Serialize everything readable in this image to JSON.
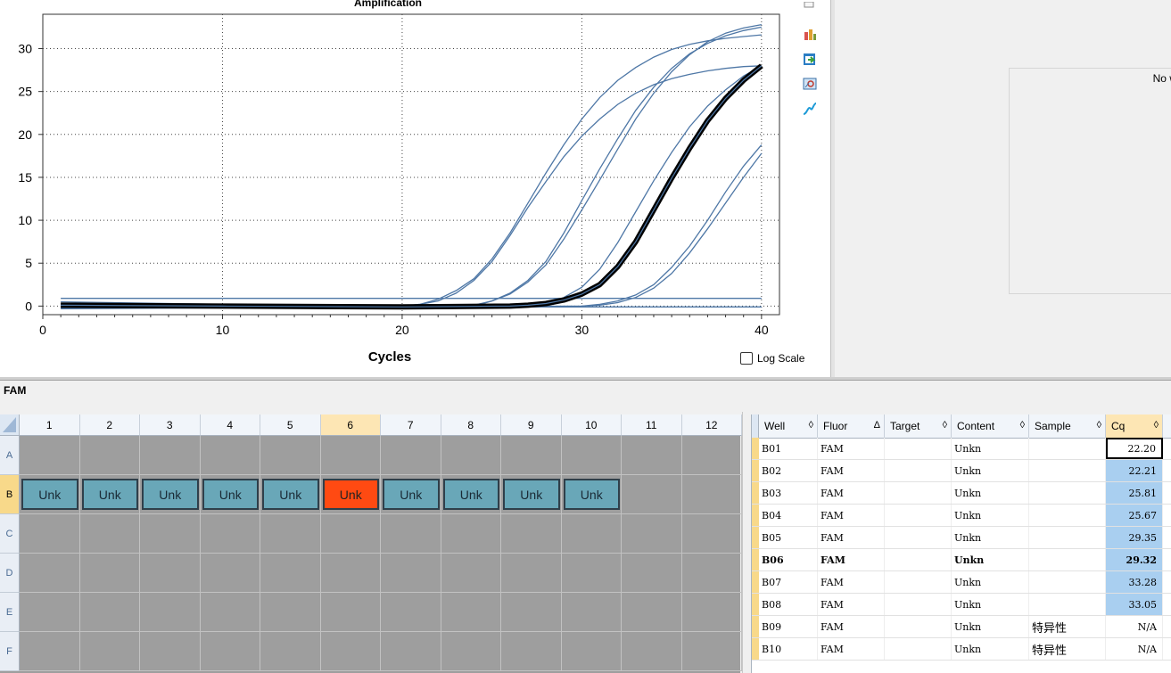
{
  "chart": {
    "title": "Amplification",
    "xlabel": "Cycles",
    "log_scale_label": "Log Scale",
    "log_scale_checked": false
  },
  "chart_data": {
    "type": "line",
    "title": "Amplification",
    "xlabel": "Cycles",
    "ylabel": "",
    "xlim": [
      0,
      41
    ],
    "ylim": [
      -1,
      34
    ],
    "xticks": [
      0,
      10,
      20,
      30,
      40
    ],
    "yticks": [
      0,
      5,
      10,
      15,
      20,
      25,
      30
    ],
    "grid": true,
    "highlight_color": "#000000",
    "series_color": "#4e77a6",
    "series": [
      {
        "name": "B01",
        "highlight": false,
        "points": [
          [
            1,
            -0.1
          ],
          [
            10,
            -0.1
          ],
          [
            20,
            0
          ],
          [
            21,
            0.2
          ],
          [
            22,
            0.8
          ],
          [
            23,
            1.8
          ],
          [
            24,
            3.2
          ],
          [
            25,
            5.5
          ],
          [
            26,
            8.5
          ],
          [
            27,
            12
          ],
          [
            28,
            15.5
          ],
          [
            29,
            18.8
          ],
          [
            30,
            21.8
          ],
          [
            31,
            24.3
          ],
          [
            32,
            26.3
          ],
          [
            33,
            27.8
          ],
          [
            34,
            29
          ],
          [
            35,
            29.9
          ],
          [
            36,
            30.5
          ],
          [
            37,
            30.9
          ],
          [
            38,
            31.2
          ],
          [
            39,
            31.4
          ],
          [
            40,
            31.6
          ]
        ]
      },
      {
        "name": "B02",
        "highlight": false,
        "points": [
          [
            1,
            0.2
          ],
          [
            10,
            0.1
          ],
          [
            20,
            0
          ],
          [
            21,
            0.2
          ],
          [
            22,
            0.6
          ],
          [
            23,
            1.5
          ],
          [
            24,
            3
          ],
          [
            25,
            5.2
          ],
          [
            26,
            8.2
          ],
          [
            27,
            11.5
          ],
          [
            28,
            14.5
          ],
          [
            29,
            17.4
          ],
          [
            30,
            19.8
          ],
          [
            31,
            21.8
          ],
          [
            32,
            23.5
          ],
          [
            33,
            24.8
          ],
          [
            34,
            25.8
          ],
          [
            35,
            26.5
          ],
          [
            36,
            27
          ],
          [
            37,
            27.4
          ],
          [
            38,
            27.7
          ],
          [
            39,
            27.9
          ],
          [
            40,
            28
          ]
        ]
      },
      {
        "name": "B03",
        "highlight": false,
        "points": [
          [
            1,
            -0.3
          ],
          [
            10,
            -0.2
          ],
          [
            20,
            -0.1
          ],
          [
            24,
            0
          ],
          [
            25,
            0.6
          ],
          [
            26,
            1.5
          ],
          [
            27,
            3
          ],
          [
            28,
            5.2
          ],
          [
            29,
            8.5
          ],
          [
            30,
            12.3
          ],
          [
            31,
            16
          ],
          [
            32,
            19.5
          ],
          [
            33,
            22.8
          ],
          [
            34,
            25.5
          ],
          [
            35,
            27.7
          ],
          [
            36,
            29.4
          ],
          [
            37,
            30.6
          ],
          [
            38,
            31.5
          ],
          [
            39,
            32.1
          ],
          [
            40,
            32.5
          ]
        ]
      },
      {
        "name": "B04",
        "highlight": false,
        "points": [
          [
            1,
            0.5
          ],
          [
            10,
            0.2
          ],
          [
            20,
            0
          ],
          [
            24,
            0.1
          ],
          [
            25,
            0.6
          ],
          [
            26,
            1.4
          ],
          [
            27,
            2.8
          ],
          [
            28,
            4.8
          ],
          [
            29,
            7.8
          ],
          [
            30,
            11.2
          ],
          [
            31,
            14.7
          ],
          [
            32,
            18.3
          ],
          [
            33,
            21.8
          ],
          [
            34,
            24.8
          ],
          [
            35,
            27.3
          ],
          [
            36,
            29.3
          ],
          [
            37,
            30.8
          ],
          [
            38,
            31.8
          ],
          [
            39,
            32.4
          ],
          [
            40,
            32.8
          ]
        ]
      },
      {
        "name": "B05",
        "highlight": false,
        "points": [
          [
            1,
            0.3
          ],
          [
            10,
            0
          ],
          [
            20,
            -0.1
          ],
          [
            26,
            0
          ],
          [
            27,
            0.1
          ],
          [
            28,
            0.4
          ],
          [
            29,
            1
          ],
          [
            30,
            2.2
          ],
          [
            31,
            4.3
          ],
          [
            32,
            7.4
          ],
          [
            33,
            11
          ],
          [
            34,
            14.6
          ],
          [
            35,
            17.9
          ],
          [
            36,
            20.9
          ],
          [
            37,
            23.3
          ],
          [
            38,
            25.2
          ],
          [
            39,
            26.8
          ],
          [
            40,
            28
          ]
        ]
      },
      {
        "name": "B06",
        "highlight": true,
        "points": [
          [
            1,
            0.1
          ],
          [
            10,
            0
          ],
          [
            20,
            -0.1
          ],
          [
            26,
            0
          ],
          [
            27,
            0.1
          ],
          [
            28,
            0.3
          ],
          [
            29,
            0.7
          ],
          [
            30,
            1.4
          ],
          [
            31,
            2.5
          ],
          [
            32,
            4.6
          ],
          [
            33,
            7.5
          ],
          [
            34,
            11.2
          ],
          [
            35,
            14.9
          ],
          [
            36,
            18.4
          ],
          [
            37,
            21.6
          ],
          [
            38,
            24.2
          ],
          [
            39,
            26.3
          ],
          [
            40,
            28
          ]
        ]
      },
      {
        "name": "B07",
        "highlight": false,
        "points": [
          [
            1,
            0
          ],
          [
            20,
            -0.1
          ],
          [
            30,
            0
          ],
          [
            31,
            0.2
          ],
          [
            32,
            0.6
          ],
          [
            33,
            1.3
          ],
          [
            34,
            2.5
          ],
          [
            35,
            4.5
          ],
          [
            36,
            7
          ],
          [
            37,
            10
          ],
          [
            38,
            13.3
          ],
          [
            39,
            16.3
          ],
          [
            40,
            18.8
          ]
        ]
      },
      {
        "name": "B08",
        "highlight": false,
        "points": [
          [
            1,
            -0.2
          ],
          [
            20,
            -0.1
          ],
          [
            30,
            0
          ],
          [
            31,
            0.1
          ],
          [
            32,
            0.4
          ],
          [
            33,
            1
          ],
          [
            34,
            2.1
          ],
          [
            35,
            3.8
          ],
          [
            36,
            6.2
          ],
          [
            37,
            9
          ],
          [
            38,
            12
          ],
          [
            39,
            15
          ],
          [
            40,
            17.8
          ]
        ]
      },
      {
        "name": "B09",
        "highlight": false,
        "points": [
          [
            1,
            0.9
          ],
          [
            40,
            0.9
          ]
        ]
      },
      {
        "name": "B10",
        "highlight": false,
        "points": [
          [
            1,
            -0.1
          ],
          [
            40,
            -0.1
          ]
        ]
      }
    ]
  },
  "right_panel": {
    "message": "No well"
  },
  "fluor_label": "FAM",
  "plate": {
    "columns": [
      "1",
      "2",
      "3",
      "4",
      "5",
      "6",
      "7",
      "8",
      "9",
      "10",
      "11",
      "12"
    ],
    "rows": [
      "A",
      "B",
      "C",
      "D",
      "E",
      "F"
    ],
    "selected_column": "6",
    "selected_row": "B",
    "filled_row": "B",
    "well_label": "Unk",
    "filled_columns": [
      "1",
      "2",
      "3",
      "4",
      "5",
      "6",
      "7",
      "8",
      "9",
      "10"
    ],
    "selected_well_column": "6"
  },
  "table": {
    "headers": [
      "Well",
      "Fluor",
      "Target",
      "Content",
      "Sample",
      "Cq"
    ],
    "sort_icons": [
      "◊",
      "Δ",
      "◊",
      "◊",
      "◊",
      "◊"
    ],
    "rows": [
      {
        "well": "B01",
        "fluor": "FAM",
        "target": "",
        "content": "Unkn",
        "sample": "",
        "cq": "22.20"
      },
      {
        "well": "B02",
        "fluor": "FAM",
        "target": "",
        "content": "Unkn",
        "sample": "",
        "cq": "22.21"
      },
      {
        "well": "B03",
        "fluor": "FAM",
        "target": "",
        "content": "Unkn",
        "sample": "",
        "cq": "25.81"
      },
      {
        "well": "B04",
        "fluor": "FAM",
        "target": "",
        "content": "Unkn",
        "sample": "",
        "cq": "25.67"
      },
      {
        "well": "B05",
        "fluor": "FAM",
        "target": "",
        "content": "Unkn",
        "sample": "",
        "cq": "29.35"
      },
      {
        "well": "B06",
        "fluor": "FAM",
        "target": "",
        "content": "Unkn",
        "sample": "",
        "cq": "29.32"
      },
      {
        "well": "B07",
        "fluor": "FAM",
        "target": "",
        "content": "Unkn",
        "sample": "",
        "cq": "33.28"
      },
      {
        "well": "B08",
        "fluor": "FAM",
        "target": "",
        "content": "Unkn",
        "sample": "",
        "cq": "33.05"
      },
      {
        "well": "B09",
        "fluor": "FAM",
        "target": "",
        "content": "Unkn",
        "sample": "特异性",
        "cq": "N/A"
      },
      {
        "well": "B10",
        "fluor": "FAM",
        "target": "",
        "content": "Unkn",
        "sample": "特异性",
        "cq": "N/A"
      }
    ],
    "selected_row": "B06",
    "highlight_color": "#a9cff0"
  },
  "toolbar_icons": [
    "copy-icon",
    "chart-settings-icon",
    "export-icon",
    "zoom-chart-icon",
    "curve-icon"
  ]
}
